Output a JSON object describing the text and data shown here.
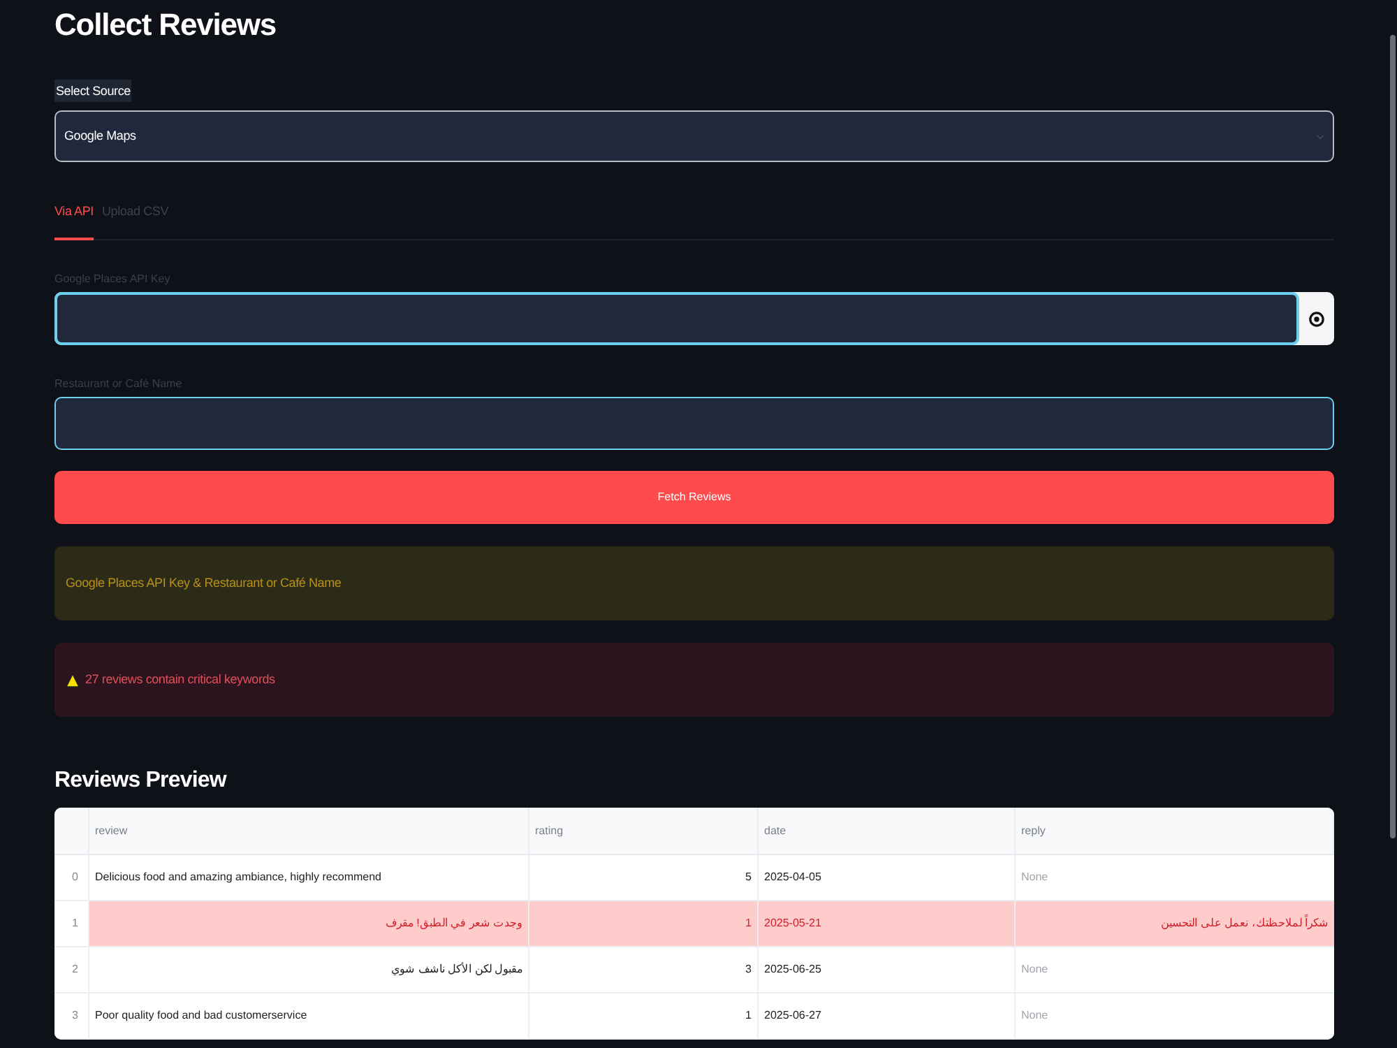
{
  "title": "Collect Reviews",
  "source_select": {
    "label": "Select Source",
    "value": "Google Maps"
  },
  "tabs": [
    {
      "label": "Via API",
      "selected": true
    },
    {
      "label": "Upload CSV",
      "selected": false
    }
  ],
  "fields": [
    {
      "kind": "password",
      "label": "Google Places API Key"
    },
    {
      "kind": "text",
      "label": "Restaurant or Café Name"
    }
  ],
  "fetch_button": "Fetch Reviews",
  "alerts": [
    {
      "kind": "warning",
      "text": "Google Places API Key & Restaurant or Café Name"
    },
    {
      "kind": "error",
      "text": "27 reviews contain critical keywords"
    }
  ],
  "preview": {
    "title": "Reviews Preview",
    "columns": [
      "review",
      "rating",
      "date",
      "reply"
    ],
    "rows": [
      {
        "index": "0",
        "flagged": false,
        "review": "Delicious food and amazing ambiance, highly recommend",
        "rating": "5",
        "date": "2025-04-05",
        "reply": {
          "text": "None",
          "null": true
        }
      },
      {
        "index": "1",
        "flagged": true,
        "review": "وجدت شعر في الطبق! مقرف",
        "rating": "1",
        "date": "2025-05-21",
        "reply": {
          "text": "شكراً لملاحظتك، نعمل على التحسين",
          "null": false
        }
      },
      {
        "index": "2",
        "flagged": false,
        "review": "مقبول لكن الأكل ناشف شوي",
        "rating": "3",
        "date": "2025-06-25",
        "reply": {
          "text": "None",
          "null": true
        }
      },
      {
        "index": "3",
        "flagged": false,
        "review": "Poor quality food and bad customerservice",
        "rating": "1",
        "date": "2025-06-27",
        "reply": {
          "text": "None",
          "null": true
        }
      }
    ]
  }
}
